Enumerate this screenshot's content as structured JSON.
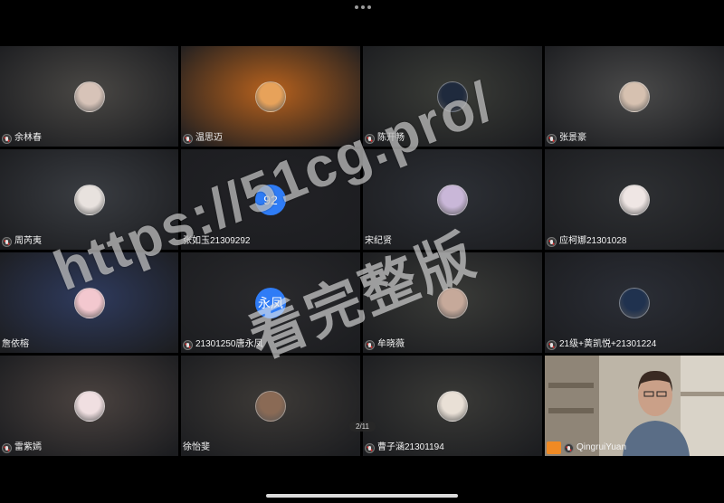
{
  "top_menu_icon": "more-dots-icon",
  "page_indicator": "2/11",
  "watermark": {
    "line1": "https://51cg.pro/",
    "line2": "看完整版"
  },
  "tiles": [
    {
      "name": "余林春",
      "mic": true,
      "tone": "#4a4845",
      "avatar_color": "#d7c3b8"
    },
    {
      "name": "温思迈",
      "mic": true,
      "tone": "#b8621d",
      "avatar_color": "#e7a25a"
    },
    {
      "name": "陈开畅",
      "mic": true,
      "tone": "#3b3d38",
      "avatar_color": "#1f2a3d"
    },
    {
      "name": "张景豪",
      "mic": true,
      "tone": "#4a4a4a",
      "avatar_color": "#d6c1b0"
    },
    {
      "name": "周芮夷",
      "mic": true,
      "tone": "#3a3d42",
      "avatar_color": "#e8e2de"
    },
    {
      "name": "张如玉21309292",
      "mic": false,
      "tone": "#222226",
      "badge": "92"
    },
    {
      "name": "宋纪贤",
      "mic": false,
      "tone": "#2d3036",
      "avatar_color": "#c9b7d8"
    },
    {
      "name": "应柯娜21301028",
      "mic": true,
      "tone": "#2e3033",
      "avatar_color": "#efe6e4"
    },
    {
      "name": "詹依榕",
      "mic": false,
      "tone": "#2f3b5e",
      "avatar_color": "#f3c8cf"
    },
    {
      "name": "21301250唐永凤",
      "mic": true,
      "tone": "#2a2a2d",
      "badge": "永凤"
    },
    {
      "name": "牟晓薇",
      "mic": true,
      "tone": "#3a3b38",
      "avatar_color": "#c6a99a"
    },
    {
      "name": "21级+黄凯悦+21301224",
      "mic": true,
      "tone": "#2b2e36",
      "avatar_color": "#20324f"
    },
    {
      "name": "雷紫嫣",
      "mic": true,
      "tone": "#4b4340",
      "avatar_color": "#f0dfe1"
    },
    {
      "name": "徐怡斐",
      "mic": false,
      "tone": "#3d3a37",
      "avatar_color": "#8a6a55"
    },
    {
      "name": "曹子涵21301194",
      "mic": true,
      "tone": "#3a3a37",
      "avatar_color": "#e9e0d6"
    },
    {
      "name": "QingruiYuan",
      "mic": true,
      "self": true,
      "tone": "#cfc8bd"
    }
  ]
}
